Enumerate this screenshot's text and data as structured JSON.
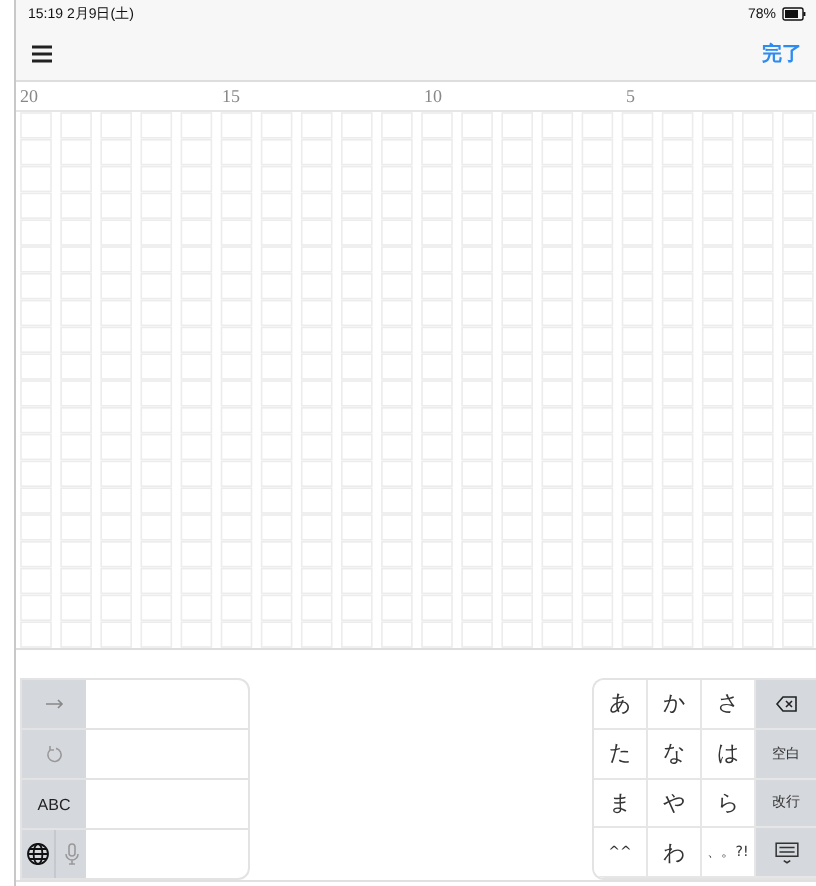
{
  "status_bar": {
    "time": "15:19  2月9日(土)",
    "battery": "78%"
  },
  "nav": {
    "done": "完了"
  },
  "ruler": [
    "20",
    "15",
    "10",
    "5"
  ],
  "keyboard": {
    "left_keys": [
      {
        "kind": "next"
      },
      {
        "kind": "undo"
      },
      {
        "kind": "text",
        "label": "ABC"
      },
      {
        "kind": "globe"
      }
    ],
    "right_keys": [
      [
        {
          "kind": "text",
          "label": "あ"
        },
        {
          "kind": "text",
          "label": "か"
        },
        {
          "kind": "text",
          "label": "さ"
        },
        {
          "kind": "delete"
        }
      ],
      [
        {
          "kind": "text",
          "label": "た"
        },
        {
          "kind": "text",
          "label": "な"
        },
        {
          "kind": "text",
          "label": "は"
        },
        {
          "kind": "action",
          "label": "空白"
        }
      ],
      [
        {
          "kind": "text",
          "label": "ま"
        },
        {
          "kind": "text",
          "label": "や"
        },
        {
          "kind": "text",
          "label": "ら"
        },
        {
          "kind": "action",
          "label": "改行"
        }
      ],
      [
        {
          "kind": "small",
          "label": "^^"
        },
        {
          "kind": "text",
          "label": "わ"
        },
        {
          "kind": "small",
          "label": "、。?!"
        },
        {
          "kind": "dismiss"
        }
      ]
    ]
  }
}
